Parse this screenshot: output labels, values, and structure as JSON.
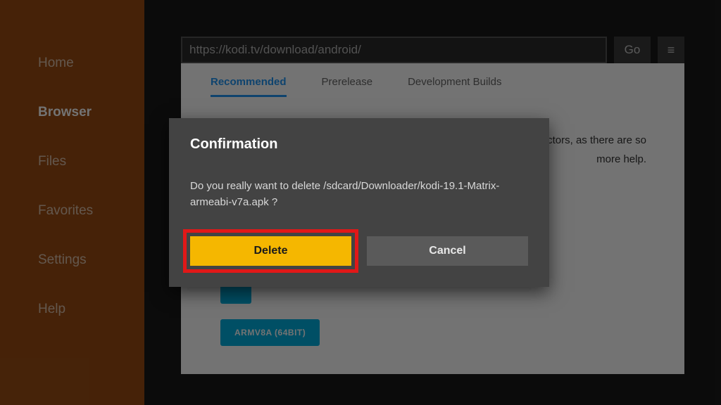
{
  "sidebar": {
    "items": [
      {
        "label": "Home"
      },
      {
        "label": "Browser"
      },
      {
        "label": "Files"
      },
      {
        "label": "Favorites"
      },
      {
        "label": "Settings"
      },
      {
        "label": "Help"
      }
    ],
    "active_index": 1
  },
  "urlbar": {
    "value": "https://kodi.tv/download/android/",
    "go_label": "Go",
    "menu_glyph": "≡"
  },
  "page": {
    "tabs": [
      {
        "label": "Recommended"
      },
      {
        "label": "Prerelease"
      },
      {
        "label": "Development Builds"
      }
    ],
    "active_tab_index": 0,
    "body_snippets": [
      "ictors, as there are so",
      "more help."
    ],
    "download_buttons": [
      {
        "label": "ARMV8A (64BIT)"
      }
    ]
  },
  "dialog": {
    "title": "Confirmation",
    "message": "Do you really want to delete /sdcard/Downloader/kodi-19.1-Matrix-armeabi-v7a.apk ?",
    "delete_label": "Delete",
    "cancel_label": "Cancel"
  }
}
